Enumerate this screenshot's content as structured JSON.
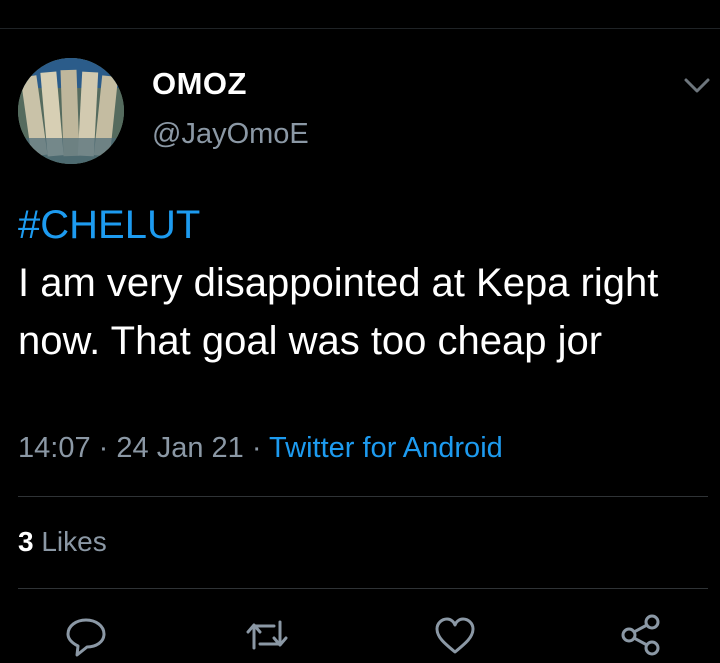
{
  "tweet": {
    "display_name": "OMOZ",
    "handle": "@JayOmoE",
    "hashtag": "#CHELUT",
    "text": "I am very disappointed at Kepa right now. That goal was too cheap jor",
    "time": "14:07",
    "date": "24 Jan 21",
    "separator": "·",
    "source": "Twitter for Android"
  },
  "stats": {
    "likes_count": "3",
    "likes_label": "Likes"
  },
  "actions": [
    {
      "name": "reply-icon"
    },
    {
      "name": "retweet-icon"
    },
    {
      "name": "like-icon"
    },
    {
      "name": "share-icon"
    }
  ],
  "colors": {
    "background": "#000000",
    "accent": "#1d9bf0",
    "secondary_text": "#8b98a5",
    "divider": "#2f3336"
  }
}
